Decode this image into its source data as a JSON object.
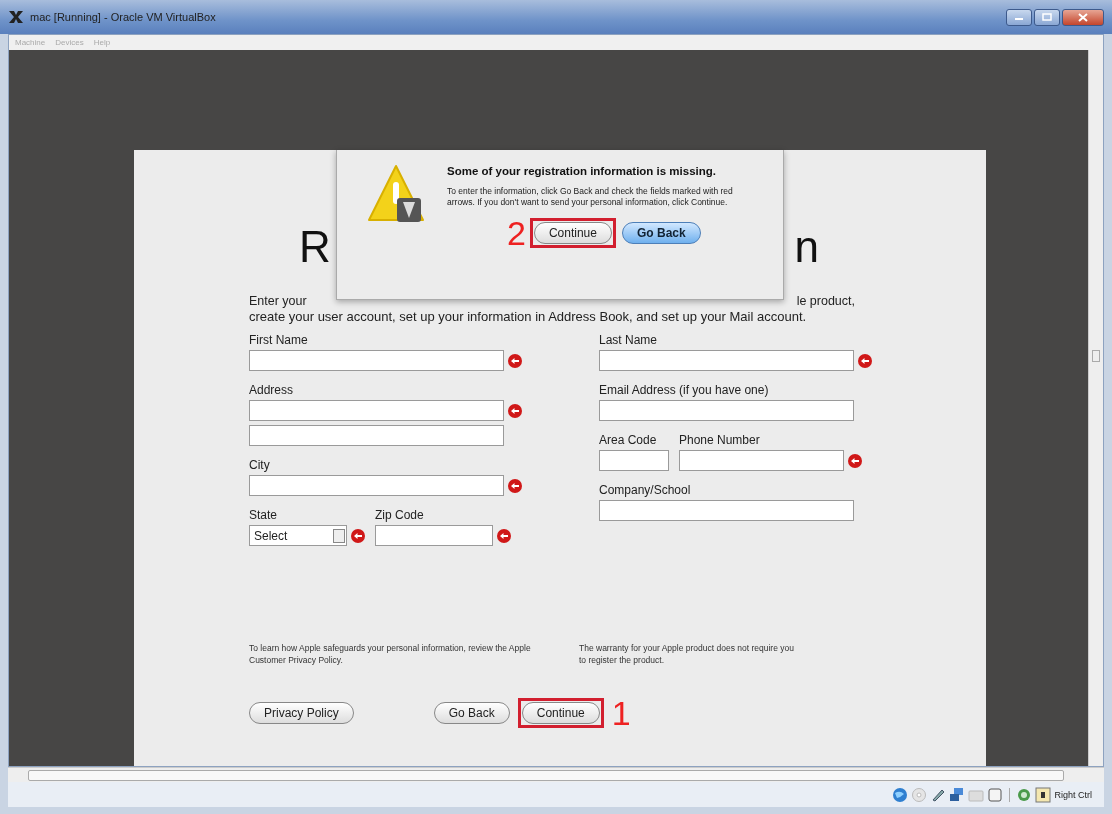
{
  "window": {
    "title": "mac [Running] - Oracle VM VirtualBox"
  },
  "menu": [
    "Machine",
    "Devices",
    "Help"
  ],
  "form": {
    "heading_left": "R",
    "heading_right": "n",
    "intro_left": "Enter your",
    "intro_right": "le product,",
    "intro_rest": "create your user account, set up your information in Address Book, and set up your Mail account.",
    "columns": [
      [
        {
          "fields": [
            {
              "label": "First Name",
              "kind": "text",
              "inputs": [
                {
                  "missing": true
                }
              ]
            }
          ]
        },
        {
          "fields": [
            {
              "label": "Address",
              "kind": "text",
              "inputs": [
                {
                  "missing": true
                },
                {
                  "missing": false
                }
              ]
            }
          ]
        },
        {
          "fields": [
            {
              "label": "City",
              "kind": "text",
              "inputs": [
                {
                  "missing": true
                }
              ]
            }
          ]
        },
        {
          "fields": [
            {
              "label": "State",
              "kind": "select",
              "value": "Select",
              "inputs": [
                {
                  "missing": true
                }
              ]
            },
            {
              "label": "Zip Code",
              "kind": "text",
              "inputs": [
                {
                  "missing": true
                }
              ]
            }
          ]
        }
      ],
      [
        {
          "fields": [
            {
              "label": "Last Name",
              "kind": "text",
              "inputs": [
                {
                  "missing": true
                }
              ]
            }
          ]
        },
        {
          "fields": [
            {
              "label": "Email Address (if you have one)",
              "kind": "text",
              "inputs": [
                {
                  "missing": false
                }
              ]
            }
          ]
        },
        {
          "fields": [
            {
              "label": "Area Code",
              "kind": "text",
              "inputs": [
                {
                  "missing": false
                }
              ]
            },
            {
              "label": "Phone Number",
              "kind": "text",
              "inputs": [
                {
                  "missing": true
                }
              ]
            }
          ]
        },
        {
          "fields": [
            {
              "label": "Company/School",
              "kind": "text",
              "inputs": [
                {
                  "missing": false
                }
              ]
            }
          ]
        }
      ]
    ],
    "notes": [
      "To learn how Apple safeguards your personal information, review the Apple Customer Privacy Policy.",
      "The warranty for your Apple product does not require you to register the product."
    ],
    "buttons": [
      {
        "label": "Privacy Policy",
        "highlighted": false
      },
      {
        "label": "Go Back",
        "highlighted": false
      },
      {
        "label": "Continue",
        "highlighted": true,
        "callout": "1"
      }
    ]
  },
  "dialog": {
    "title": "Some of your registration information is missing.",
    "message": "To enter the information, click Go Back and check the fields marked with red arrows. If you don't want to send your personal information, click Continue.",
    "buttons": [
      {
        "label": "Continue",
        "default": false,
        "highlighted": true,
        "callout": "2"
      },
      {
        "label": "Go Back",
        "default": true,
        "highlighted": false
      }
    ]
  },
  "status_bar": {
    "host_key": "Right Ctrl"
  }
}
